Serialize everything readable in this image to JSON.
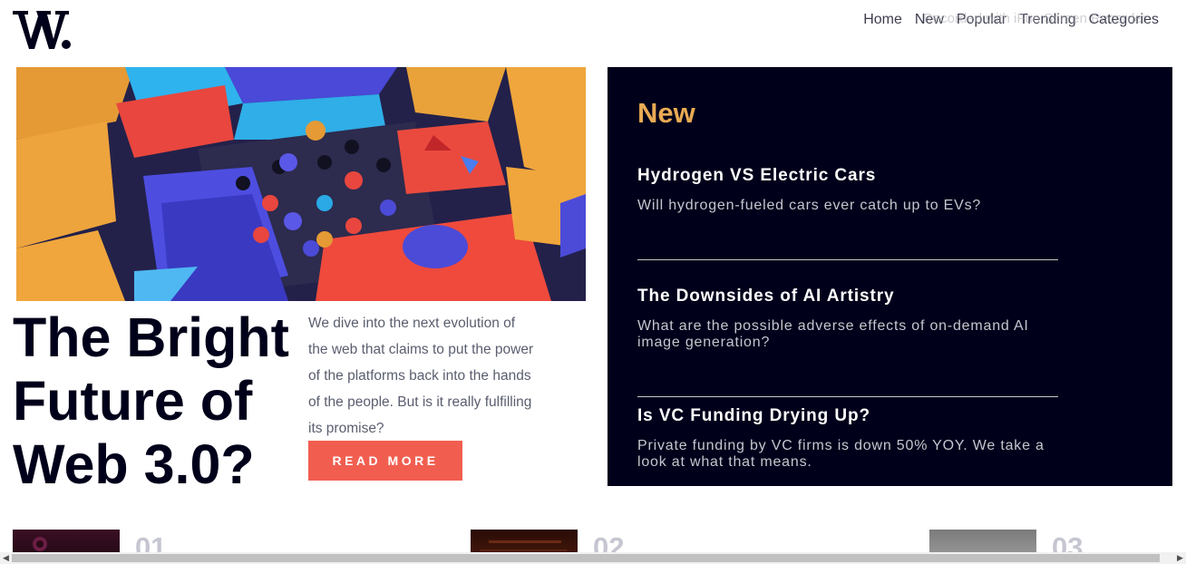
{
  "brand": {
    "logo_text": "W."
  },
  "nav": {
    "items": [
      "Home",
      "New",
      "Popular",
      "Trending",
      "Categories"
    ]
  },
  "watermark": "Recorded with iFun Screen Recorder",
  "hero": {
    "title": "The Bright Future of Web 3.0?",
    "intro": "We dive into the next evolution of the web that claims to put the power of the platforms back into the hands of the people. But is it really fulfilling its promise?",
    "cta": "READ MORE"
  },
  "new_section": {
    "title": "New",
    "items": [
      {
        "title": "Hydrogen VS Electric Cars",
        "summary": "Will hydrogen-fueled cars ever catch up to EVs?"
      },
      {
        "title": "The Downsides of AI Artistry",
        "summary": "What are the possible adverse effects of on-demand AI image generation?"
      },
      {
        "title": "Is VC Funding Drying Up?",
        "summary": "Private funding by VC firms is down 50% YOY. We take a look at what that means."
      }
    ]
  },
  "numbered": [
    {
      "number": "01"
    },
    {
      "number": "02"
    },
    {
      "number": "03"
    }
  ],
  "scrollbar": {
    "left_arrow": "◀",
    "right_arrow": "▶"
  },
  "colors": {
    "dark_navy": "#00001a",
    "accent_orange": "#e9ab53",
    "button_red": "#f15e50",
    "body_gray": "#5a5e6f",
    "light_gray": "#c5c6d0"
  }
}
